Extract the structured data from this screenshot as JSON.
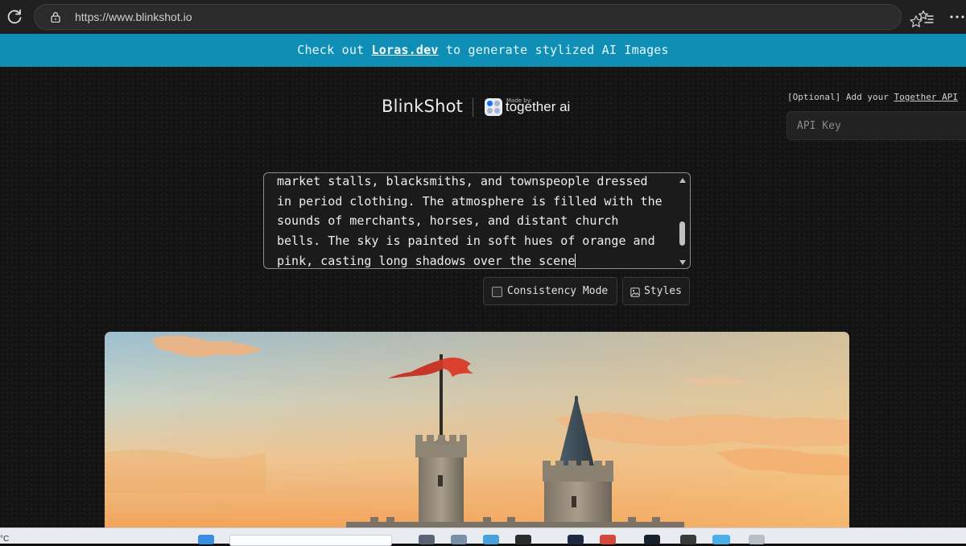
{
  "browser": {
    "url": "https://www.blinkshot.io",
    "icons": [
      "reload-icon",
      "lock-icon",
      "star-icon",
      "favorites-icon",
      "more-icon"
    ]
  },
  "banner": {
    "prefix": "Check out ",
    "link": "Loras.dev",
    "suffix": " to generate stylized AI Images"
  },
  "header": {
    "brand": "BlinkShot",
    "made_by": "Made by:",
    "partner": "together ai"
  },
  "api": {
    "label_prefix": "[Optional] Add your ",
    "label_link": "Together API",
    "placeholder": "API Key"
  },
  "prompt": {
    "value": "market stalls, blacksmiths, and townspeople dressed\nin period clothing. The atmosphere is filled with the\nsounds of merchants, horses, and distant church\nbells. The sky is painted in soft hues of orange and\npink, casting long shadows over the scene"
  },
  "controls": {
    "consistency_label": "Consistency Mode",
    "consistency_checked": false,
    "styles_label": "Styles"
  },
  "taskbar": {
    "temp": "°C"
  },
  "colors": {
    "banner": "#0f8fb5",
    "background": "#141414",
    "accent_flag": "#d9402e"
  }
}
